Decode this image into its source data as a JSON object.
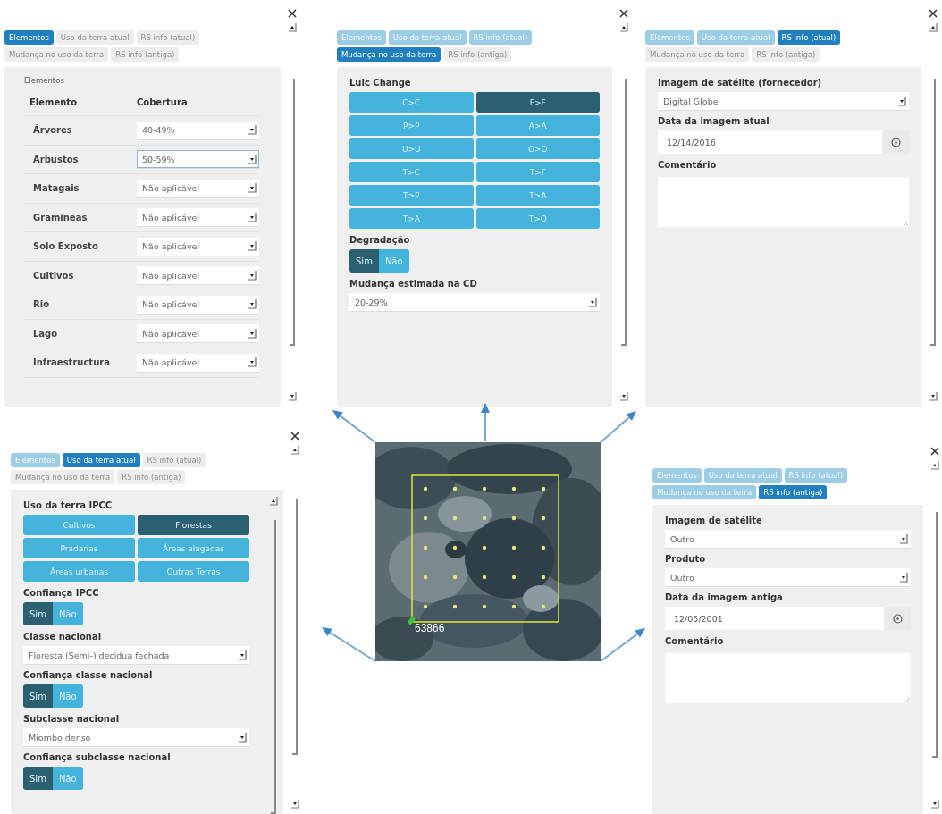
{
  "panels": [
    {
      "tabs": [
        {
          "label": "Elementos",
          "selected": true,
          "done": false
        },
        {
          "label": "Uso da terra atual",
          "selected": false,
          "done": false
        },
        {
          "label": "RS info (atual)",
          "selected": false,
          "done": false
        },
        {
          "label": "Mudança no uso da terra",
          "selected": false,
          "done": false
        },
        {
          "label": "RS info (antiga)",
          "selected": false,
          "done": false
        }
      ],
      "sections": [
        {
          "kind": "table",
          "caption": "Elementos",
          "columns": [
            "Elemento",
            "Cobertura"
          ],
          "rows": [
            {
              "name": "Árvores",
              "value": "40-49%",
              "focused": false
            },
            {
              "name": "Arbustos",
              "value": "50-59%",
              "focused": true
            },
            {
              "name": "Matagais",
              "value": "Não aplicável",
              "focused": false
            },
            {
              "name": "Gramineas",
              "value": "Não aplicável",
              "focused": false
            },
            {
              "name": "Solo Exposto",
              "value": "Não aplicável",
              "focused": false
            },
            {
              "name": "Cultivos",
              "value": "Não aplicável",
              "focused": false
            },
            {
              "name": "Rio",
              "value": "Não aplicável",
              "focused": false
            },
            {
              "name": "Lago",
              "value": "Não aplicável",
              "focused": false
            },
            {
              "name": "Infraestructura",
              "value": "Não aplicável",
              "focused": false
            }
          ]
        }
      ]
    },
    {
      "tabs": [
        {
          "label": "Elementos",
          "selected": false,
          "done": true
        },
        {
          "label": "Uso da terra atual",
          "selected": false,
          "done": true
        },
        {
          "label": "RS info (atual)",
          "selected": false,
          "done": true
        },
        {
          "label": "Mudança no uso da terra",
          "selected": true,
          "done": false
        },
        {
          "label": "RS info (antiga)",
          "selected": false,
          "done": false
        }
      ],
      "sections": [
        {
          "kind": "label",
          "text": "Lulc Change"
        },
        {
          "kind": "choices",
          "options": [
            {
              "label": "C>C",
              "selected": false
            },
            {
              "label": "F>F",
              "selected": true
            },
            {
              "label": "P>P",
              "selected": false
            },
            {
              "label": "A>A",
              "selected": false
            },
            {
              "label": "U>U",
              "selected": false
            },
            {
              "label": "O>O",
              "selected": false
            },
            {
              "label": "T>C",
              "selected": false
            },
            {
              "label": "T>F",
              "selected": false
            },
            {
              "label": "T>P",
              "selected": false
            },
            {
              "label": "T>A",
              "selected": false
            },
            {
              "label": "T>A",
              "selected": false
            },
            {
              "label": "T>O",
              "selected": false
            }
          ]
        },
        {
          "kind": "label",
          "text": "Degradação"
        },
        {
          "kind": "toggle",
          "options": [
            {
              "label": "Sim",
              "selected": true
            },
            {
              "label": "Não",
              "selected": false
            }
          ]
        },
        {
          "kind": "label",
          "text": "Mudança estimada na CD"
        },
        {
          "kind": "select",
          "value": "20-29%"
        }
      ]
    },
    {
      "tabs": [
        {
          "label": "Elementos",
          "selected": false,
          "done": true
        },
        {
          "label": "Uso da terra atual",
          "selected": false,
          "done": true
        },
        {
          "label": "RS info (atual)",
          "selected": true,
          "done": false
        },
        {
          "label": "Mudança no uso da terra",
          "selected": false,
          "done": false
        },
        {
          "label": "RS info (antiga)",
          "selected": false,
          "done": false
        }
      ],
      "sections": [
        {
          "kind": "label",
          "text": "Imagem de satélite (fornecedor)"
        },
        {
          "kind": "select",
          "value": "Digital Globe"
        },
        {
          "kind": "label",
          "text": "Data da imagem atual"
        },
        {
          "kind": "date",
          "value": "12/14/2016"
        },
        {
          "kind": "label",
          "text": "Comentário"
        },
        {
          "kind": "textarea"
        }
      ]
    },
    {
      "tabs": [
        {
          "label": "Elementos",
          "selected": false,
          "done": true
        },
        {
          "label": "Uso da terra atual",
          "selected": true,
          "done": false
        },
        {
          "label": "RS info (atual)",
          "selected": false,
          "done": false
        },
        {
          "label": "Mudança no uso da terra",
          "selected": false,
          "done": false
        },
        {
          "label": "RS info (antiga)",
          "selected": false,
          "done": false
        }
      ],
      "card_scrollbar": true,
      "sections": [
        {
          "kind": "label",
          "text": "Uso da terra IPCC"
        },
        {
          "kind": "choices",
          "options": [
            {
              "label": "Cultivos",
              "selected": false
            },
            {
              "label": "Florestas",
              "selected": true
            },
            {
              "label": "Pradarias",
              "selected": false
            },
            {
              "label": "Áreas alagadas",
              "selected": false
            },
            {
              "label": "Áreas urbanas",
              "selected": false
            },
            {
              "label": "Outras Terras",
              "selected": false
            }
          ]
        },
        {
          "kind": "label",
          "text": "Confiança IPCC"
        },
        {
          "kind": "toggle",
          "options": [
            {
              "label": "Sim",
              "selected": true
            },
            {
              "label": "Não",
              "selected": false
            }
          ]
        },
        {
          "kind": "label",
          "text": "Classe nacional"
        },
        {
          "kind": "select",
          "value": "Floresta (Semi-) decidua fechada"
        },
        {
          "kind": "label",
          "text": "Confiança classe nacional"
        },
        {
          "kind": "toggle",
          "options": [
            {
              "label": "Sim",
              "selected": true
            },
            {
              "label": "Não",
              "selected": false
            }
          ]
        },
        {
          "kind": "label",
          "text": "Subclasse nacional"
        },
        {
          "kind": "select",
          "value": "Miombo denso"
        },
        {
          "kind": "label",
          "text": "Confiança subclasse nacional"
        },
        {
          "kind": "toggle",
          "options": [
            {
              "label": "Sim",
              "selected": true
            },
            {
              "label": "Não",
              "selected": false
            }
          ]
        }
      ]
    },
    {
      "tabs": [
        {
          "label": "Elementos",
          "selected": false,
          "done": true
        },
        {
          "label": "Uso da terra atual",
          "selected": false,
          "done": true
        },
        {
          "label": "RS info (atual)",
          "selected": false,
          "done": true
        },
        {
          "label": "Mudança no uso da terra",
          "selected": false,
          "done": true
        },
        {
          "label": "RS info (antiga)",
          "selected": true,
          "done": false
        }
      ],
      "sections": [
        {
          "kind": "label",
          "text": "Imagem de satélite"
        },
        {
          "kind": "select",
          "value": "Outro"
        },
        {
          "kind": "label",
          "text": "Produto"
        },
        {
          "kind": "select",
          "value": "Outro"
        },
        {
          "kind": "label",
          "text": "Data da imagem antiga"
        },
        {
          "kind": "date",
          "value": "12/05/2001"
        },
        {
          "kind": "label",
          "text": "Comentário"
        },
        {
          "kind": "textarea"
        }
      ]
    }
  ],
  "map": {
    "kind": "picture",
    "plot_label": "63866"
  }
}
